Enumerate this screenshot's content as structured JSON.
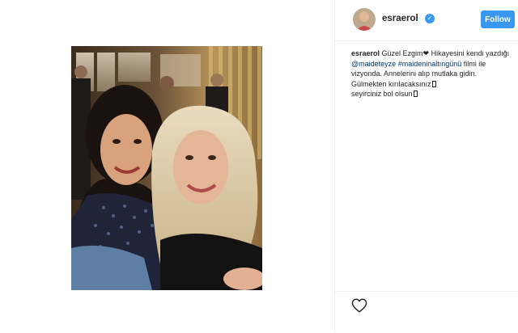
{
  "post": {
    "photo_alt": "Selfie of two women",
    "icon": "photo"
  },
  "header": {
    "username": "esraerol",
    "verified_icon": "verified-badge-icon",
    "follow_label": "Follow"
  },
  "caption": {
    "username": "esraerol",
    "part1": " Güzel Ezgim❤ Hikayesini kendi yazdığı ",
    "mention": "@maideteyze",
    "space": " ",
    "hashtag": "#maideninaltıngünü",
    "part2": " filmi ile vizyonda. Annelerini alıp mutlaka gidin. Gülmekten kırılacaksınız",
    "part3": " seyirciniz bol olsun"
  },
  "actions": {
    "like_icon": "heart-icon"
  },
  "colors": {
    "accent": "#3897f0",
    "link": "#003569",
    "border": "#efefef"
  }
}
